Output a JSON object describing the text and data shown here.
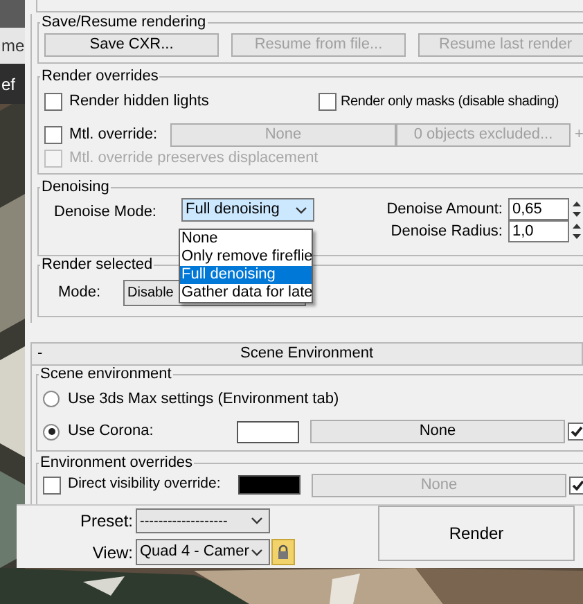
{
  "background_app": {
    "texts": [
      "me",
      "ef"
    ]
  },
  "save_resume": {
    "title": "Save/Resume rendering",
    "buttons": [
      {
        "label": "Save CXR...",
        "disabled": false
      },
      {
        "label": "Resume from file...",
        "disabled": true
      },
      {
        "label": "Resume last render",
        "disabled": true
      }
    ]
  },
  "render_overrides": {
    "title": "Render overrides",
    "render_hidden_lights": {
      "label": "Render hidden lights",
      "checked": false
    },
    "render_only_masks": {
      "label": "Render only masks (disable shading)",
      "checked": false
    },
    "mtl_override": {
      "label": "Mtl. override:",
      "checked": false,
      "material": "None",
      "excluded": "0 objects excluded...",
      "add": "+",
      "disabled": true
    },
    "preserves_displacement": {
      "label": "Mtl. override preserves displacement",
      "checked": false,
      "disabled": true
    }
  },
  "denoising": {
    "title": "Denoising",
    "mode_label": "Denoise Mode:",
    "mode_value": "Full denoising",
    "dropdown_open": true,
    "options": [
      {
        "label": "None",
        "selected": false
      },
      {
        "label": "Only remove fireflie",
        "selected": false
      },
      {
        "label": "Full denoising",
        "selected": true
      },
      {
        "label": "Gather data for late",
        "selected": false
      }
    ],
    "amount_label": "Denoise Amount:",
    "amount": "0,65",
    "radius_label": "Denoise Radius:",
    "radius": "1,0"
  },
  "render_selected": {
    "title": "Render selected",
    "mode_label": "Mode:",
    "mode_value": "Disable"
  },
  "scene_environment_rollout": {
    "collapse": "-",
    "title": "Scene Environment"
  },
  "scene_environment": {
    "title": "Scene environment",
    "options": [
      {
        "label": "Use 3ds Max settings (Environment tab)",
        "selected": false
      },
      {
        "label": "Use Corona:",
        "selected": true
      }
    ],
    "map": "None",
    "map_enabled": true
  },
  "environment_overrides": {
    "title": "Environment overrides",
    "direct_visibility": {
      "label": "Direct visibility override:",
      "checked": false,
      "map": "None",
      "map_enabled": true
    }
  },
  "bottom": {
    "preset_label": "Preset:",
    "preset": "-------------------",
    "view_label": "View:",
    "view": "Quad 4 - Camer",
    "locked": true,
    "render": "Render"
  }
}
